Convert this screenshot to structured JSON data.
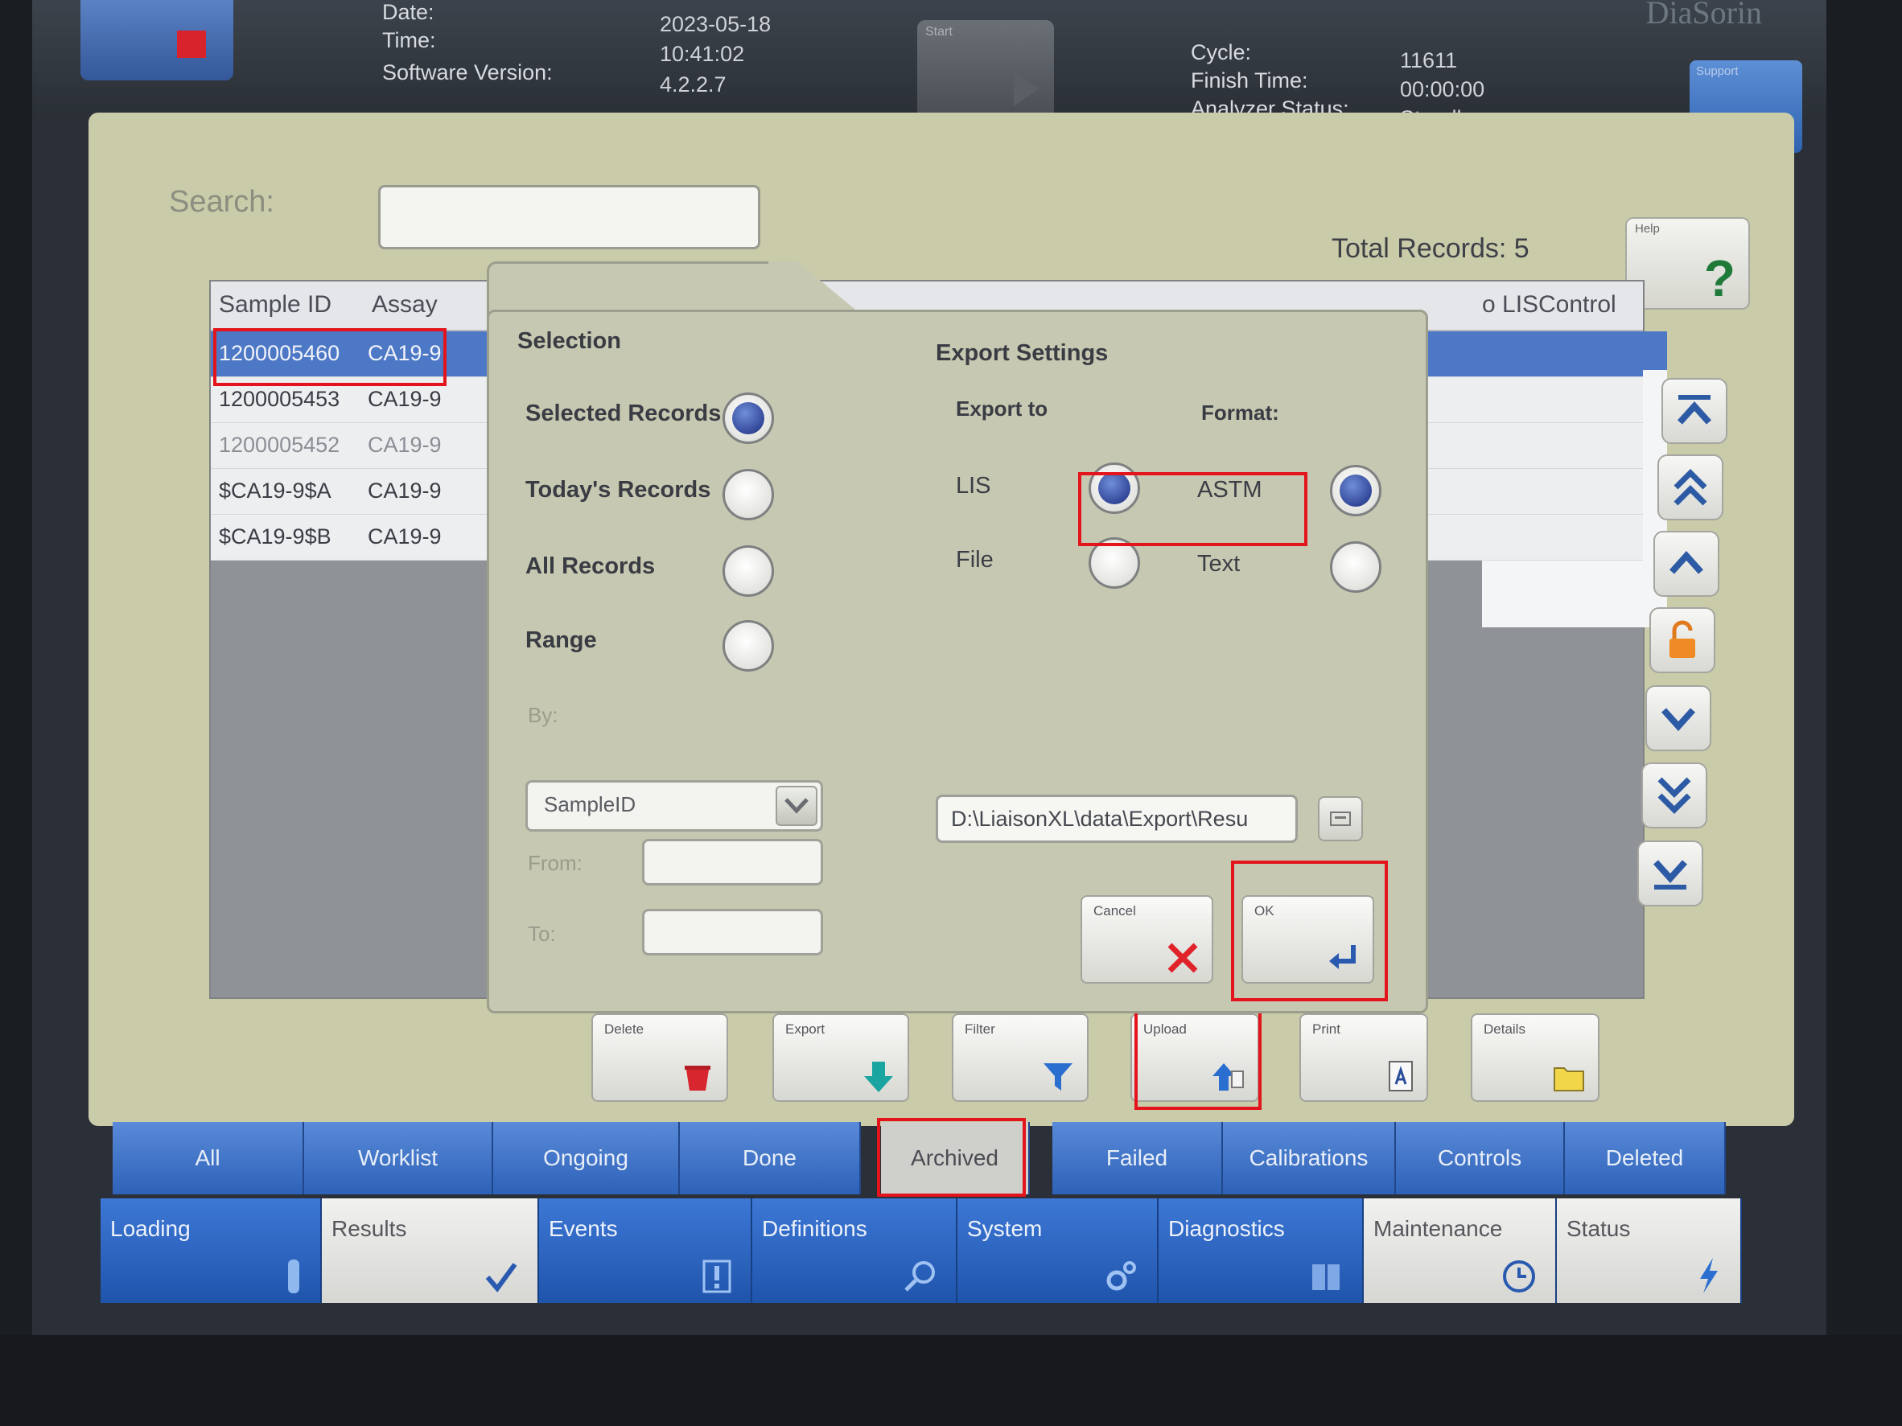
{
  "header": {
    "date_label": "Date:",
    "time_label": "Time:",
    "version_label": "Software Version:",
    "date": "2023-05-18",
    "time": "10:41:02",
    "version": "4.2.2.7",
    "start_label": "Start",
    "cycle_label": "Cycle:",
    "finish_label": "Finish Time:",
    "status_label": "Analyzer Status:",
    "cycle": "11611",
    "finish": "00:00:00",
    "status": "Standby",
    "brand": "DiaSorin",
    "support_label": "Support"
  },
  "search": {
    "label": "Search:",
    "value": ""
  },
  "total_records": "Total Records: 5",
  "help_label": "Help",
  "table": {
    "columns": [
      "Sample ID",
      "Assay",
      "o LIS",
      "Control"
    ],
    "rows": [
      {
        "sample_id": "1200005460",
        "assay": "CA19-9",
        "selected": true
      },
      {
        "sample_id": "1200005453",
        "assay": "CA19-9"
      },
      {
        "sample_id": "1200005452",
        "assay": "CA19-9"
      },
      {
        "sample_id": "$CA19-9$A",
        "assay": "CA19-9"
      },
      {
        "sample_id": "$CA19-9$B",
        "assay": "CA19-9"
      }
    ]
  },
  "dialog": {
    "selection_title": "Selection",
    "export_title": "Export Settings",
    "export_to_label": "Export to",
    "format_label": "Format:",
    "selection_options": [
      {
        "label": "Selected Records",
        "checked": true
      },
      {
        "label": "Today's Records",
        "checked": false
      },
      {
        "label": "All Records",
        "checked": false
      },
      {
        "label": "Range",
        "checked": false
      }
    ],
    "export_to": [
      {
        "label": "LIS",
        "checked": true
      },
      {
        "label": "File",
        "checked": false
      }
    ],
    "formats": [
      {
        "label": "ASTM",
        "checked": true
      },
      {
        "label": "Text",
        "checked": false
      }
    ],
    "by_label": "By:",
    "by_value": "SampleID",
    "from_label": "From:",
    "to_label": "To:",
    "from_value": "",
    "to_value": "",
    "path": "D:\\LiaisonXL\\data\\Export\\Resu",
    "cancel_label": "Cancel",
    "ok_label": "OK"
  },
  "toolbar": {
    "delete": "Delete",
    "export": "Export",
    "filter": "Filter",
    "upload": "Upload",
    "print": "Print",
    "details": "Details"
  },
  "tabs": [
    "All",
    "Worklist",
    "Ongoing",
    "Done",
    "Archived",
    "Failed",
    "Calibrations",
    "Controls",
    "Deleted"
  ],
  "active_tab": "Archived",
  "nav": [
    "Loading",
    "Results",
    "Events",
    "Definitions",
    "System",
    "Diagnostics",
    "Maintenance",
    "Status"
  ],
  "colors": {
    "accent": "#2d62b8",
    "highlight": "#e3141c",
    "panel": "#c9cba9"
  }
}
